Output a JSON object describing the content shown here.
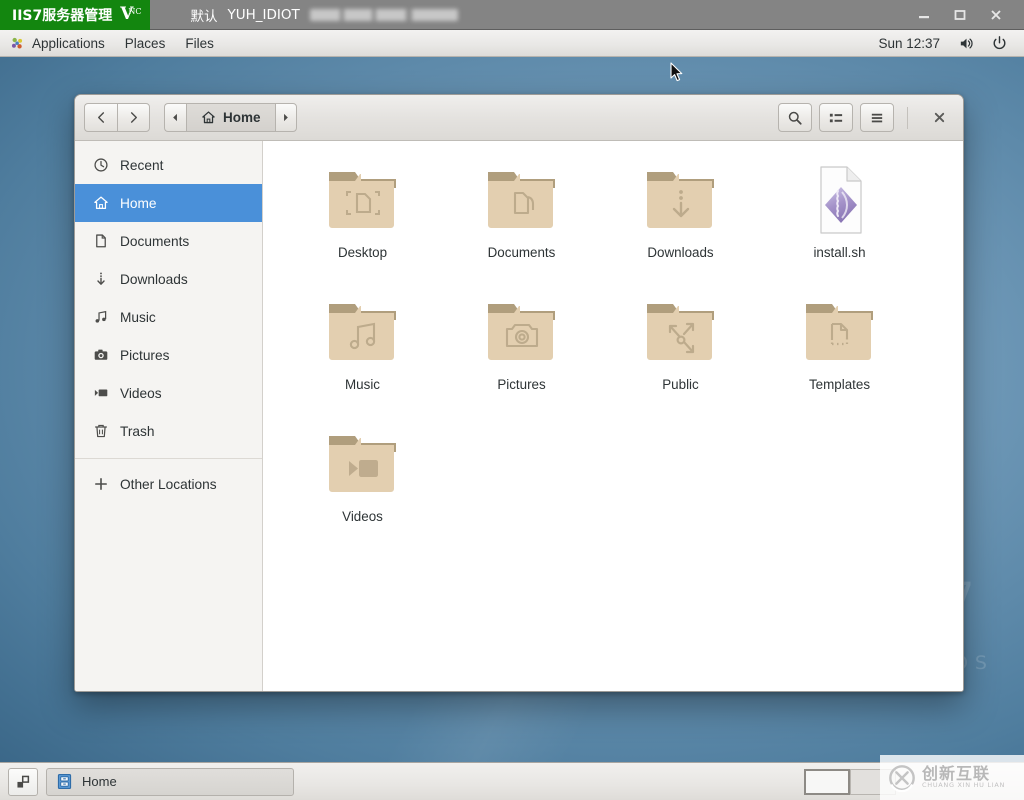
{
  "vnc_bar": {
    "brand_text": "IIS7服务器管理",
    "brand_logo": "V",
    "brand_logo_sub": "NC",
    "session_profile": "默认",
    "session_name": "YUH_IDIOT",
    "minimize_label": "minimize",
    "maximize_label": "maximize",
    "close_label": "close"
  },
  "top_panel": {
    "applications_label": "Applications",
    "places_label": "Places",
    "files_label": "Files",
    "clock": "Sun 12:37",
    "volume_icon": "volume-icon",
    "power_icon": "power-icon",
    "apps_icon": "gnome-foot-icon"
  },
  "file_window": {
    "headerbar": {
      "back_label": "Back",
      "forward_label": "Forward",
      "path_prev_label": "Previous path",
      "path_next_label": "Next path",
      "current_path": "Home",
      "search_label": "Search",
      "view_toggle_label": "List view",
      "menu_label": "Menu",
      "close_label": "Close"
    },
    "sidebar": {
      "items": [
        {
          "label": "Recent",
          "icon": "clock-icon",
          "selected": false
        },
        {
          "label": "Home",
          "icon": "home-icon",
          "selected": true
        },
        {
          "label": "Documents",
          "icon": "document-icon",
          "selected": false
        },
        {
          "label": "Downloads",
          "icon": "download-icon",
          "selected": false
        },
        {
          "label": "Music",
          "icon": "music-icon",
          "selected": false
        },
        {
          "label": "Pictures",
          "icon": "camera-icon",
          "selected": false
        },
        {
          "label": "Videos",
          "icon": "video-icon",
          "selected": false
        },
        {
          "label": "Trash",
          "icon": "trash-icon",
          "selected": false
        }
      ],
      "other_locations_label": "Other Locations",
      "other_locations_icon": "plus-icon"
    },
    "files": [
      {
        "name": "Desktop",
        "type": "folder",
        "emblem": "desktop-emblem"
      },
      {
        "name": "Documents",
        "type": "folder",
        "emblem": "documents-emblem"
      },
      {
        "name": "Downloads",
        "type": "folder",
        "emblem": "downloads-emblem"
      },
      {
        "name": "install.sh",
        "type": "script",
        "emblem": "script-emblem"
      },
      {
        "name": "Music",
        "type": "folder",
        "emblem": "music-emblem"
      },
      {
        "name": "Pictures",
        "type": "folder",
        "emblem": "pictures-emblem"
      },
      {
        "name": "Public",
        "type": "folder",
        "emblem": "public-emblem"
      },
      {
        "name": "Templates",
        "type": "folder",
        "emblem": "templates-emblem"
      },
      {
        "name": "Videos",
        "type": "folder",
        "emblem": "videos-emblem"
      }
    ]
  },
  "taskbar": {
    "show_desktop_label": "Show desktop",
    "window_button_label": "Home",
    "window_button_icon": "file-manager-icon",
    "workspaces": [
      {
        "name": "Workspace 1",
        "active": true
      },
      {
        "name": "Workspace 2",
        "active": false
      }
    ]
  },
  "wallpaper": {
    "mark_number": "7",
    "mark_text": "TOS"
  },
  "watermark": {
    "chinese": "创新互联",
    "pinyin": "CHUANG XIN HU LIAN"
  },
  "colors": {
    "vnc_brand_green": "#13860f",
    "vnc_bar_gray": "#848484",
    "sidebar_selection_blue": "#4a90d9",
    "folder_body": "#e0cbab",
    "folder_tab": "#b09e7d",
    "desktop_blue": "#4f7d9e"
  }
}
